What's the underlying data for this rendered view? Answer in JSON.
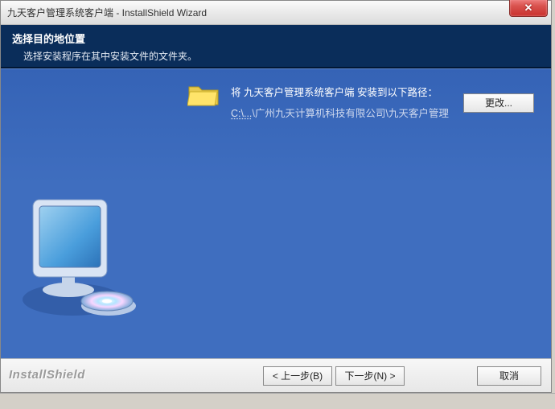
{
  "window": {
    "title": "九天客户管理系统客户端 - InstallShield Wizard",
    "close_symbol": "✕"
  },
  "header": {
    "heading": "选择目的地位置",
    "subheading": "选择安装程序在其中安装文件的文件夹。"
  },
  "body": {
    "install_line": "将 九天客户管理系统客户端 安装到以下路径：",
    "path_prefix": "C:\\...",
    "path_rest": "\\广州九天计算机科技有限公司\\九天客户管理",
    "change_label": "更改..."
  },
  "footer": {
    "brand": "InstallShield",
    "back_label": "< 上一步(B)",
    "next_label": "下一步(N) >",
    "cancel_label": "取消"
  }
}
